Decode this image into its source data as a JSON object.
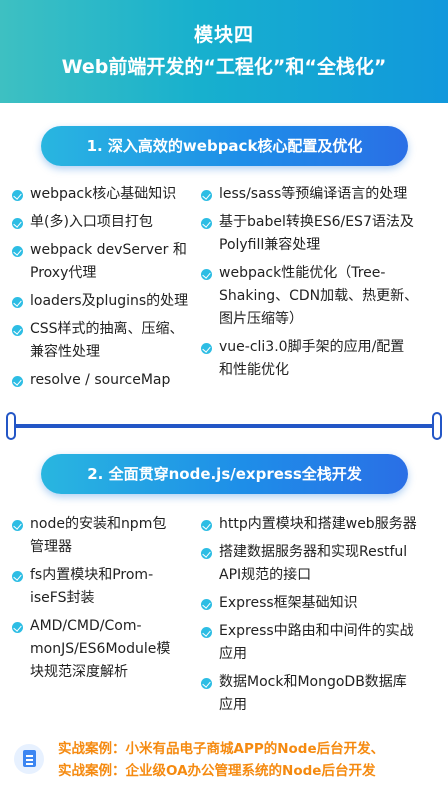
{
  "header": {
    "line1": "模块四",
    "line2": "Web前端开发的“工程化”和“全栈化”"
  },
  "section1": {
    "title": "1. 深入高效的webpack核心配置及优化",
    "left": [
      [
        "webpack核心基础知识"
      ],
      [
        "单(多)入口项目打包"
      ],
      [
        "webpack devServer 和",
        "Proxy代理"
      ],
      [
        "loaders及plugins的处理"
      ],
      [
        "CSS样式的抽离、压缩、",
        "兼容性处理"
      ],
      [
        "resolve / sourceMap"
      ]
    ],
    "right": [
      [
        "less/sass等预编译语言的处理"
      ],
      [
        "基于babel转换ES6/ES7语法及",
        "Polyfill兼容处理"
      ],
      [
        "webpack性能优化（Tree-",
        "Shaking、CDN加载、热更新、",
        "图片压缩等）"
      ],
      [
        "vue-cli3.0脚手架的应用/配置",
        "和性能优化"
      ]
    ]
  },
  "section2": {
    "title": "2. 全面贯穿node.js/express全栈开发",
    "left": [
      [
        "node的安装和npm包",
        "管理器"
      ],
      [
        "fs内置模块和Prom-",
        "iseFS封装"
      ],
      [
        "AMD/CMD/Com-",
        "monJS/ES6Module模",
        "块规范深度解析"
      ]
    ],
    "right": [
      [
        "http内置模块和搭建web服务器"
      ],
      [
        "搭建数据服务器和实现Restful",
        "API规范的接口"
      ],
      [
        "Express框架基础知识"
      ],
      [
        "Express中路由和中间件的实战",
        "应用"
      ],
      [
        "数据Mock和MongoDB数据库",
        "应用"
      ]
    ]
  },
  "cases": [
    "实战案例：小米有品电子商城APP的Node后台开发、",
    "实战案例：企业级OA办公管理系统的Node后台开发"
  ],
  "icons": {
    "bullet": "check-circle-icon",
    "case": "document-icon"
  },
  "colors": {
    "accent": "#2dbde4",
    "divider": "#2356c6",
    "case_text": "#f58a10"
  }
}
